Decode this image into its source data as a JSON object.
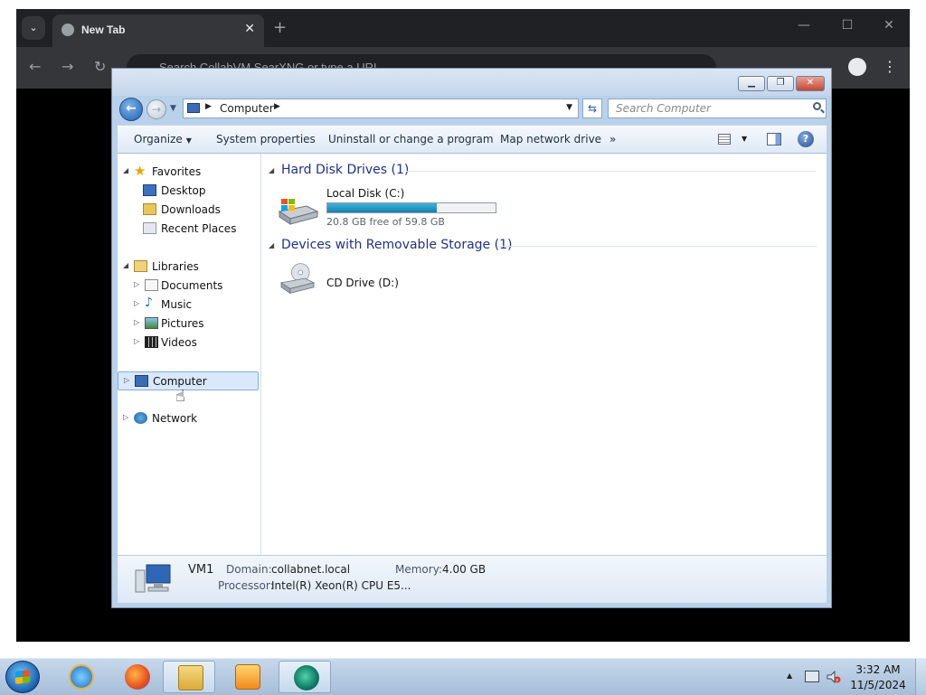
{
  "browser": {
    "tab_title": "New Tab",
    "new_tab_symbol": "+",
    "omnibox_placeholder": "Search CollabVM SearXNG or type a URL",
    "tab_search_symbol": "⌄",
    "nav_back": "←",
    "nav_forward": "→",
    "nav_reload": "↻",
    "win_min": "—",
    "win_max": "☐",
    "win_close": "✕",
    "menu": "⋮"
  },
  "explorer": {
    "address": {
      "segment": "Computer"
    },
    "search": {
      "placeholder": "Search Computer"
    },
    "toolbar": {
      "organize": "Organize",
      "system_properties": "System properties",
      "uninstall": "Uninstall or change a program",
      "map_drive": "Map network drive",
      "more": "»",
      "help": "?"
    },
    "nav": {
      "favorites": "Favorites",
      "desktop": "Desktop",
      "downloads": "Downloads",
      "recent_places": "Recent Places",
      "libraries": "Libraries",
      "documents": "Documents",
      "music": "Music",
      "pictures": "Pictures",
      "videos": "Videos",
      "computer": "Computer",
      "network": "Network"
    },
    "groups": {
      "hdd": {
        "label": "Hard Disk Drives (1)",
        "drive_name": "Local Disk (C:)",
        "free_text": "20.8 GB free of 59.8 GB",
        "used_fraction": 0.652
      },
      "removable": {
        "label": "Devices with Removable Storage (1)",
        "drive_name": "CD Drive (D:)"
      }
    },
    "details": {
      "name": "VM1",
      "domain_label": "Domain:",
      "domain_value": "collabnet.local",
      "memory_label": "Memory:",
      "memory_value": "4.00 GB",
      "processor_label": "Processor:",
      "processor_value": "Intel(R) Xeon(R) CPU E5..."
    }
  },
  "taskbar": {
    "apps": [
      "internet-explorer",
      "firefox",
      "windows-explorer",
      "media-player",
      "browser"
    ],
    "time": "3:32 AM",
    "date": "11/5/2024"
  },
  "colors": {
    "chrome_dark": "#202124",
    "explorer_frame": "#b9d1ea",
    "group_header": "#1e3287",
    "capacity_fill": "#1680b0"
  }
}
